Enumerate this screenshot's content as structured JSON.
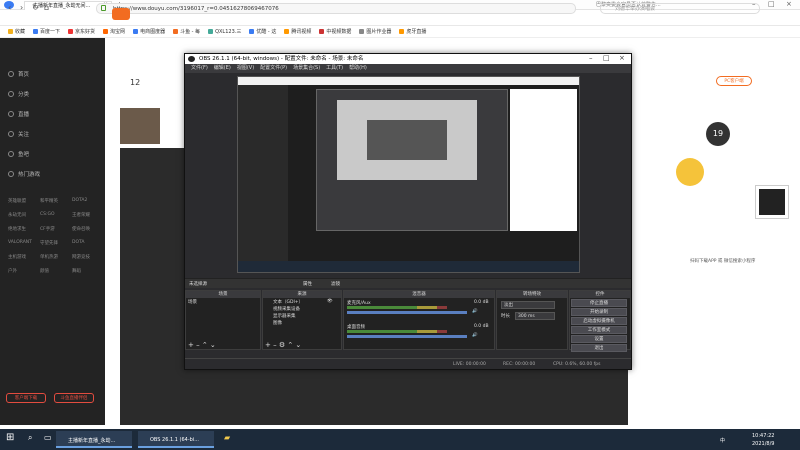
{
  "browser": {
    "tab_title": "主播新年直播_永劫无间...",
    "tab_close": "×",
    "new_tab": "+",
    "notice": "巴黎奥委会官员否认曾警告...",
    "url": "https://www.douyu.com/3196017_r=0.0451627806946707​6",
    "search_placeholder": "刘德华举办演唱会",
    "bookmarks": [
      {
        "label": "收藏",
        "color": "#f2b01e"
      },
      {
        "label": "百度一下",
        "color": "#3a7bf2"
      },
      {
        "label": "京东好货",
        "color": "#e33"
      },
      {
        "label": "淘宝网",
        "color": "#f60"
      },
      {
        "label": "电商图度器",
        "color": "#3a7bf2"
      },
      {
        "label": "斗鱼 - 每",
        "color": "#f26c21"
      },
      {
        "label": "QXL123.三",
        "color": "#4a9"
      },
      {
        "label": "优酷 - 这",
        "color": "#3a7bf2"
      },
      {
        "label": "腾讯视频",
        "color": "#f90"
      },
      {
        "label": "中视频数据",
        "color": "#c33"
      },
      {
        "label": "图片作业器",
        "color": "#888"
      },
      {
        "label": "虎牙直播",
        "color": "#f90"
      }
    ],
    "win_min": "–",
    "win_max": "□",
    "win_close": "×"
  },
  "douyu": {
    "sidebar": [
      {
        "label": "首页"
      },
      {
        "label": "分类"
      },
      {
        "label": "直播"
      },
      {
        "label": "关注"
      },
      {
        "label": "鱼吧"
      },
      {
        "label": "热门游戏"
      }
    ],
    "categories": [
      "英雄联盟",
      "和平精英",
      "DOTA2",
      "永劫无间",
      "CS:GO",
      "王者荣耀",
      "绝地求生",
      "CF手游",
      "使命召唤",
      "VALORANT",
      "守望先锋",
      "DOTA",
      "主机游戏",
      "单机热游",
      "网游竞技",
      "户外",
      "颜值",
      "舞蹈"
    ],
    "btn_left": "客户端下载",
    "btn_right": "斗鱼直播伴侣",
    "count": "12",
    "pc_badge": "PC客户端",
    "level": "19",
    "bottom_hint": "扫码下载APP 或 微信搜索小程序"
  },
  "obs": {
    "title": "OBS 26.1.1 (64-bit, windows) - 配置文件: 未命名 - 场景: 未命名",
    "menu": [
      "文件(F)",
      "编辑(E)",
      "视图(V)",
      "配置文件(P)",
      "场景集合(S)",
      "工具(T)",
      "帮助(H)"
    ],
    "no_source": "未选择源",
    "properties": "属性",
    "filters": "滤镜",
    "docks": {
      "scenes": "场景",
      "sources": "来源",
      "mixer": "混音器",
      "transitions": "转场特效",
      "controls": "控件"
    },
    "scene_items": [
      "场景"
    ],
    "source_items": [
      "文本（GDI+）",
      "视频采集设备",
      "显示器采集",
      "图像"
    ],
    "mixer_channels": [
      {
        "name": "麦克风/Aux",
        "db": "0.0 dB"
      },
      {
        "name": "桌面音频",
        "db": "0.0 dB"
      }
    ],
    "transition": {
      "type": "淡出",
      "duration_label": "时长",
      "duration": "300 ms"
    },
    "controls": [
      "停止直播",
      "开始录制",
      "启动虚拟摄像机",
      "工作室模式",
      "设置",
      "退出"
    ],
    "status": {
      "live": "LIVE: 00:00:00",
      "rec": "REC: 00:00:00",
      "cpu": "CPU: 0.6%, 60.00 fps"
    }
  },
  "taskbar": {
    "start": "⊞",
    "items": [
      "主播新年直播_永劫...",
      "OBS 26.1.1 (64-bi..."
    ],
    "time": "10:47:22",
    "date": "2021/8/9",
    "lang": "中"
  }
}
